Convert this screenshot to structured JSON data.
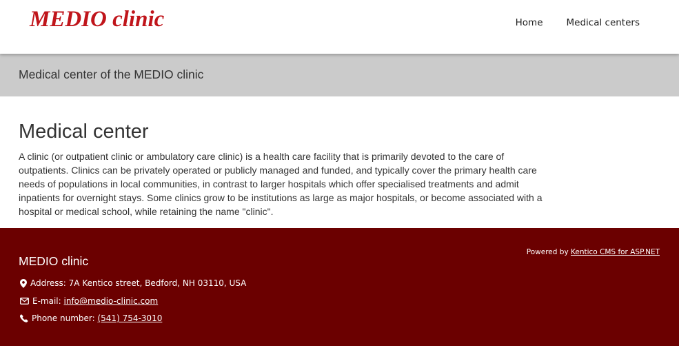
{
  "header": {
    "logo_text": "MEDIO clinic",
    "nav": [
      {
        "label": "Home"
      },
      {
        "label": "Medical centers"
      }
    ]
  },
  "banner": {
    "title": "Medical center of the MEDIO clinic"
  },
  "main": {
    "heading": "Medical center",
    "body": "A clinic (or outpatient clinic or ambulatory care clinic) is a health care facility that is primarily devoted to the care of outpatients. Clinics can be privately operated or publicly managed and funded, and typically cover the primary health care needs of populations in local communities, in contrast to larger hospitals which offer specialised treatments and admit inpatients for overnight stays. Some clinics grow to be institutions as large as major hospitals, or become associated with a hospital or medical school, while retaining the name \"clinic\"."
  },
  "footer": {
    "brand": "MEDIO clinic",
    "powered_prefix": "Powered by",
    "powered_link": "Kentico CMS for ASP.NET",
    "address_label": "Address:",
    "address_value": "7A Kentico street, Bedford, NH 03110, USA",
    "email_label": "E-mail:",
    "email_value": "info@medio-clinic.com",
    "phone_label": "Phone number:",
    "phone_value": "(541) 754-3010",
    "icons": [
      "map-marker-icon",
      "envelope-icon",
      "phone-icon"
    ]
  },
  "colors": {
    "logo": "#c0151b",
    "banner_bg": "#cbcbcb",
    "footer_bg": "#6b0000"
  }
}
